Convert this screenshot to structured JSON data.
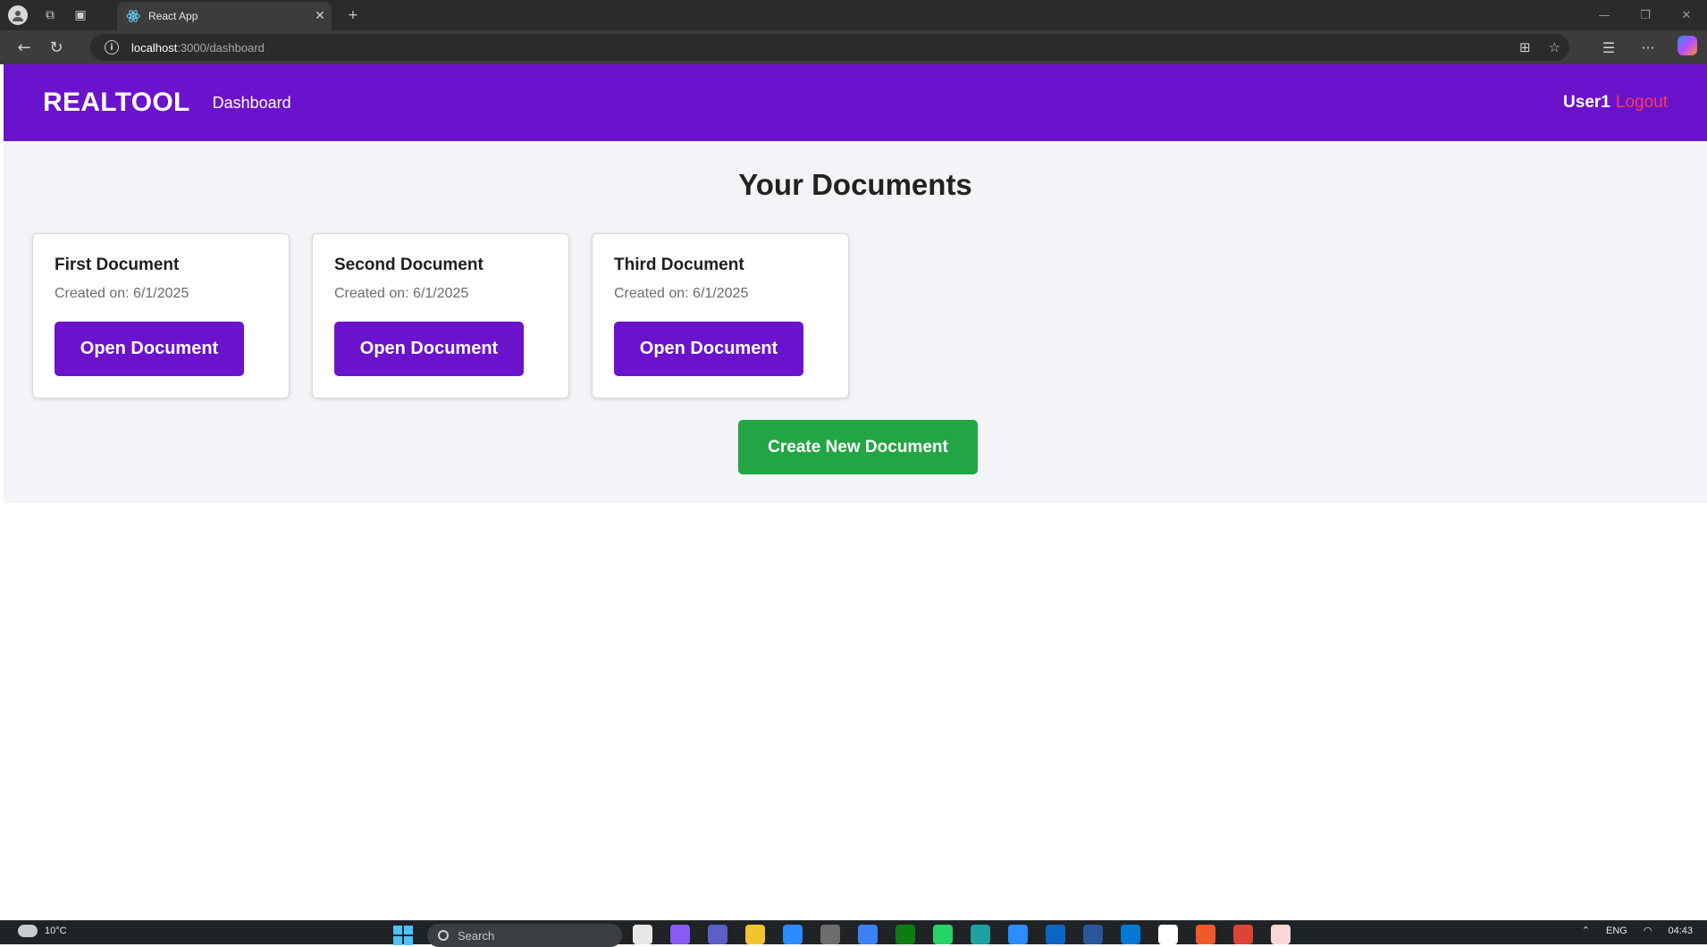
{
  "browser": {
    "tab_title": "React App",
    "url_host": "localhost",
    "url_rest": ":3000/dashboard"
  },
  "nav": {
    "brand": "REALTOOL",
    "link": "Dashboard",
    "username": "User1",
    "logout": "Logout"
  },
  "main": {
    "title": "Your Documents",
    "documents": [
      {
        "title": "First Document",
        "created": "Created on: 6/1/2025",
        "button": "Open Document"
      },
      {
        "title": "Second Document",
        "created": "Created on: 6/1/2025",
        "button": "Open Document"
      },
      {
        "title": "Third Document",
        "created": "Created on: 6/1/2025",
        "button": "Open Document"
      }
    ],
    "create_button": "Create New Document"
  },
  "taskbar": {
    "temperature": "10°C",
    "search_placeholder": "Search",
    "language": "ENG",
    "time": "04:43"
  },
  "colors": {
    "brand_purple": "#6b12cd",
    "create_green": "#23a544",
    "logout_red": "#ff3b4a",
    "content_bg": "#f3f4f7"
  }
}
